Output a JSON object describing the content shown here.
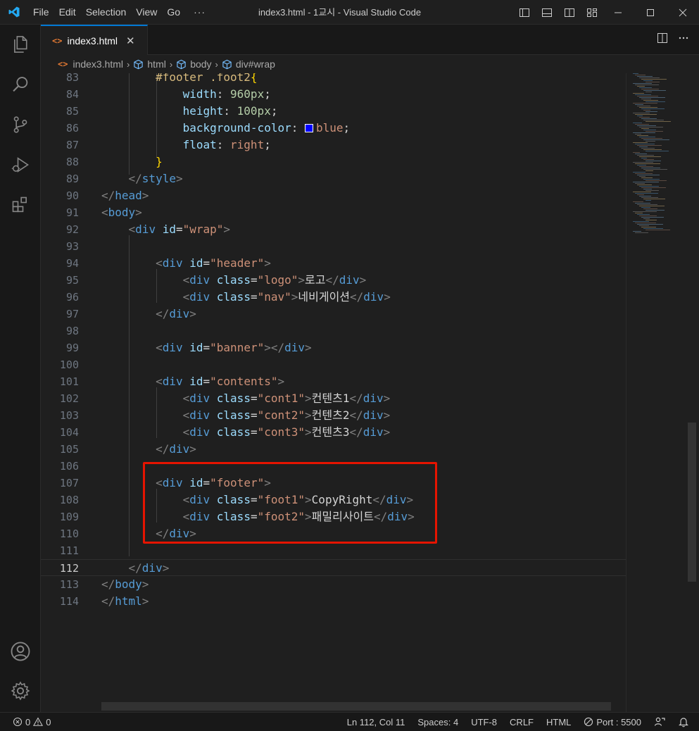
{
  "window": {
    "title": "index3.html - 1교시 - Visual Studio Code",
    "menu": [
      "File",
      "Edit",
      "Selection",
      "View",
      "Go"
    ],
    "menu_more": "···"
  },
  "activity_bar": [
    "explorer-icon",
    "search-icon",
    "source-control-icon",
    "run-debug-icon",
    "extensions-icon",
    "account-icon",
    "settings-gear-icon"
  ],
  "tab": {
    "label": "index3.html",
    "icon": "<>",
    "close": "✕"
  },
  "breadcrumb": {
    "file": "index3.html",
    "items": [
      "html",
      "body",
      "div#wrap"
    ]
  },
  "editor": {
    "current_line": 112,
    "lines": [
      {
        "n": "83",
        "text": "        #footer .foot2{"
      },
      {
        "n": "84",
        "text": "            width: 960px;"
      },
      {
        "n": "85",
        "text": "            height: 100px;"
      },
      {
        "n": "86",
        "text": "            background-color: blue;"
      },
      {
        "n": "87",
        "text": "            float: right;"
      },
      {
        "n": "88",
        "text": "        }"
      },
      {
        "n": "89",
        "text": "    </style>"
      },
      {
        "n": "90",
        "text": "</head>"
      },
      {
        "n": "91",
        "text": "<body>"
      },
      {
        "n": "92",
        "text": "    <div id=\"wrap\">"
      },
      {
        "n": "93",
        "text": ""
      },
      {
        "n": "94",
        "text": "        <div id=\"header\">"
      },
      {
        "n": "95",
        "text": "            <div class=\"logo\">로고</div>"
      },
      {
        "n": "96",
        "text": "            <div class=\"nav\">네비게이션</div>"
      },
      {
        "n": "97",
        "text": "        </div>"
      },
      {
        "n": "98",
        "text": ""
      },
      {
        "n": "99",
        "text": "        <div id=\"banner\"></div>"
      },
      {
        "n": "100",
        "text": ""
      },
      {
        "n": "101",
        "text": "        <div id=\"contents\">"
      },
      {
        "n": "102",
        "text": "            <div class=\"cont1\">컨텐츠1</div>"
      },
      {
        "n": "103",
        "text": "            <div class=\"cont2\">컨텐츠2</div>"
      },
      {
        "n": "104",
        "text": "            <div class=\"cont3\">컨텐츠3</div>"
      },
      {
        "n": "105",
        "text": "        </div>"
      },
      {
        "n": "106",
        "text": ""
      },
      {
        "n": "107",
        "text": "        <div id=\"footer\">"
      },
      {
        "n": "108",
        "text": "            <div class=\"foot1\">CopyRight</div>"
      },
      {
        "n": "109",
        "text": "            <div class=\"foot2\">패밀리사이트</div>"
      },
      {
        "n": "110",
        "text": "        </div>"
      },
      {
        "n": "111",
        "text": ""
      },
      {
        "n": "112",
        "text": "    </div>"
      },
      {
        "n": "113",
        "text": "</body>"
      },
      {
        "n": "114",
        "text": "</html>"
      }
    ],
    "swatch_color": "#0000ff"
  },
  "statusbar": {
    "errors": "0",
    "warnings": "0",
    "position": "Ln 112, Col 11",
    "spaces": "Spaces: 4",
    "encoding": "UTF-8",
    "eol": "CRLF",
    "language": "HTML",
    "port": "Port : 5500"
  },
  "colors": {
    "accent": "#0078d4",
    "highlight_box": "#e51400",
    "vscode_blue": "#23a9f2"
  }
}
